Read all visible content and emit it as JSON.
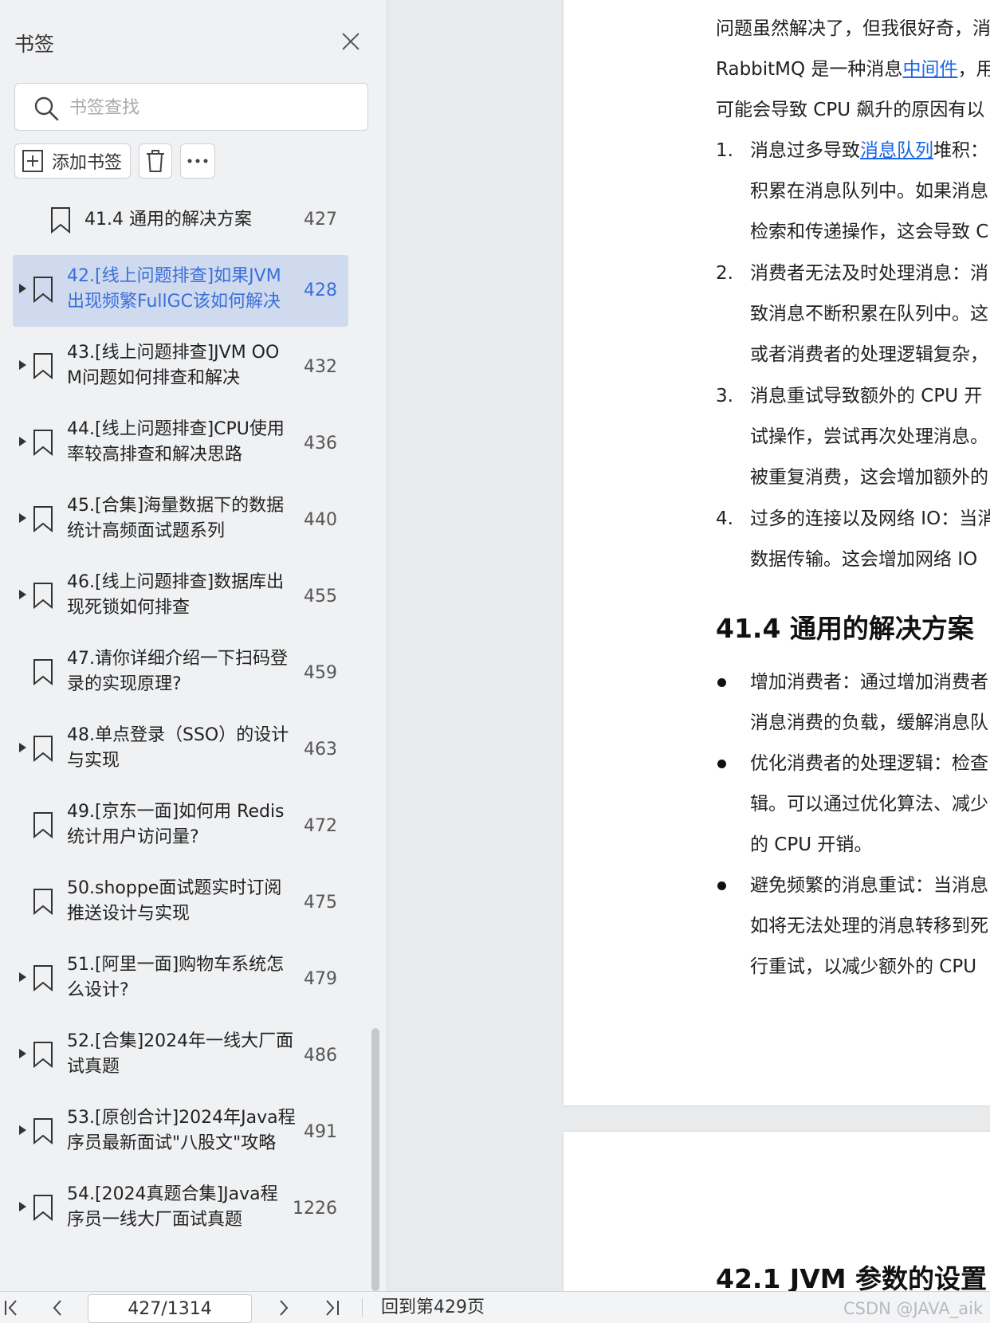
{
  "sidebar": {
    "title": "书签",
    "search_placeholder": "书签查找",
    "add_bookmark_label": "添加书签",
    "bookmarks": [
      {
        "line1": "41.4 通用的解决方案",
        "line2": "",
        "page": "427",
        "expandable": false,
        "active": false
      },
      {
        "line1": "42.[线上问题排查]如果JVM",
        "line2": "出现频繁FullGC该如何解决",
        "page": "428",
        "expandable": true,
        "active": true
      },
      {
        "line1": "43.[线上问题排查]JVM OO",
        "line2": "M问题如何排查和解决",
        "page": "432",
        "expandable": true,
        "active": false
      },
      {
        "line1": "44.[线上问题排查]CPU使用",
        "line2": "率较高排查和解决思路",
        "page": "436",
        "expandable": true,
        "active": false
      },
      {
        "line1": "45.[合集]海量数据下的数据",
        "line2": "统计高频面试题系列",
        "page": "440",
        "expandable": true,
        "active": false
      },
      {
        "line1": "46.[线上问题排查]数据库出",
        "line2": "现死锁如何排查",
        "page": "455",
        "expandable": true,
        "active": false
      },
      {
        "line1": "47.请你详细介绍一下扫码登",
        "line2": "录的实现原理?",
        "page": "459",
        "expandable": false,
        "active": false
      },
      {
        "line1": "48.单点登录（SSO）的设计",
        "line2": "与实现",
        "page": "463",
        "expandable": true,
        "active": false
      },
      {
        "line1": "49.[京东一面]如何用 Redis",
        "line2": "统计用户访问量?",
        "page": "472",
        "expandable": false,
        "active": false
      },
      {
        "line1": "50.shoppe面试题实时订阅",
        "line2": "推送设计与实现",
        "page": "475",
        "expandable": false,
        "active": false
      },
      {
        "line1": "51.[阿里一面]购物车系统怎",
        "line2": "么设计?",
        "page": "479",
        "expandable": true,
        "active": false
      },
      {
        "line1": "52.[合集]2024年一线大厂面",
        "line2": "试真题",
        "page": "486",
        "expandable": true,
        "active": false
      },
      {
        "line1": "53.[原创合计]2024年Java程",
        "line2": "序员最新面试\"八股文\"攻略",
        "page": "491",
        "expandable": true,
        "active": false
      },
      {
        "line1": "54.[2024真题合集]Java程",
        "line2": "序员一线大厂面试真题",
        "page": "1226",
        "expandable": true,
        "active": false
      }
    ]
  },
  "document": {
    "intro_line1": "问题虽然解决了，但我很好奇，消",
    "intro_line2_a": "RabbitMQ 是一种消息",
    "intro_line2_link": "中间件",
    "intro_line2_b": "，用",
    "intro_line3": "可能会导致 CPU 飙升的原因有以",
    "list": [
      {
        "n": "1.",
        "a": "消息过多导致",
        "link": "消息队列",
        "b": "堆积：",
        "cont": [
          "积累在消息队列中。如果消息",
          "检索和传递操作，这会导致 C"
        ]
      },
      {
        "n": "2.",
        "a": "消费者无法及时处理消息：消",
        "link": "",
        "b": "",
        "cont": [
          "致消息不断积累在队列中。这",
          "或者消费者的处理逻辑复杂，"
        ]
      },
      {
        "n": "3.",
        "a": "消息重试导致额外的 CPU 开",
        "link": "",
        "b": "",
        "cont": [
          "试操作，尝试再次处理消息。",
          "被重复消费，这会增加额外的"
        ]
      },
      {
        "n": "4.",
        "a": "过多的连接以及网络 IO：当消",
        "link": "",
        "b": "",
        "cont": [
          "数据传输。这会增加网络 IO"
        ]
      }
    ],
    "section_heading": "41.4  通用的解决方案",
    "bullets": [
      [
        "增加消费者：通过增加消费者",
        "消息消费的负载，缓解消息队"
      ],
      [
        "优化消费者的处理逻辑：检查",
        "辑。可以通过优化算法、减少",
        "的 CPU 开销。"
      ],
      [
        "避免频繁的消息重试：当消息",
        "如将无法处理的消息转移到死",
        "行重试，以减少额外的 CPU"
      ]
    ],
    "next_heading": "42.1 JVM 参数的设置"
  },
  "bottom_bar": {
    "page_indicator": "427/1314",
    "back_to_page": "回到第429页",
    "watermark": "CSDN @JAVA_aik"
  },
  "icons": {
    "close": "close-icon",
    "search": "search-icon",
    "add_bookmark": "add-bookmark-icon",
    "delete": "trash-icon",
    "more": "more-icon",
    "bookmark": "bookmark-icon",
    "first_page": "first-page-icon",
    "prev_page": "chevron-left-icon",
    "next_page": "chevron-right-icon",
    "last_page": "last-page-icon"
  },
  "colors": {
    "active_bookmark_bg": "#cfdaef",
    "active_bookmark_text": "#3a6fd8",
    "link": "#1a66e8"
  }
}
